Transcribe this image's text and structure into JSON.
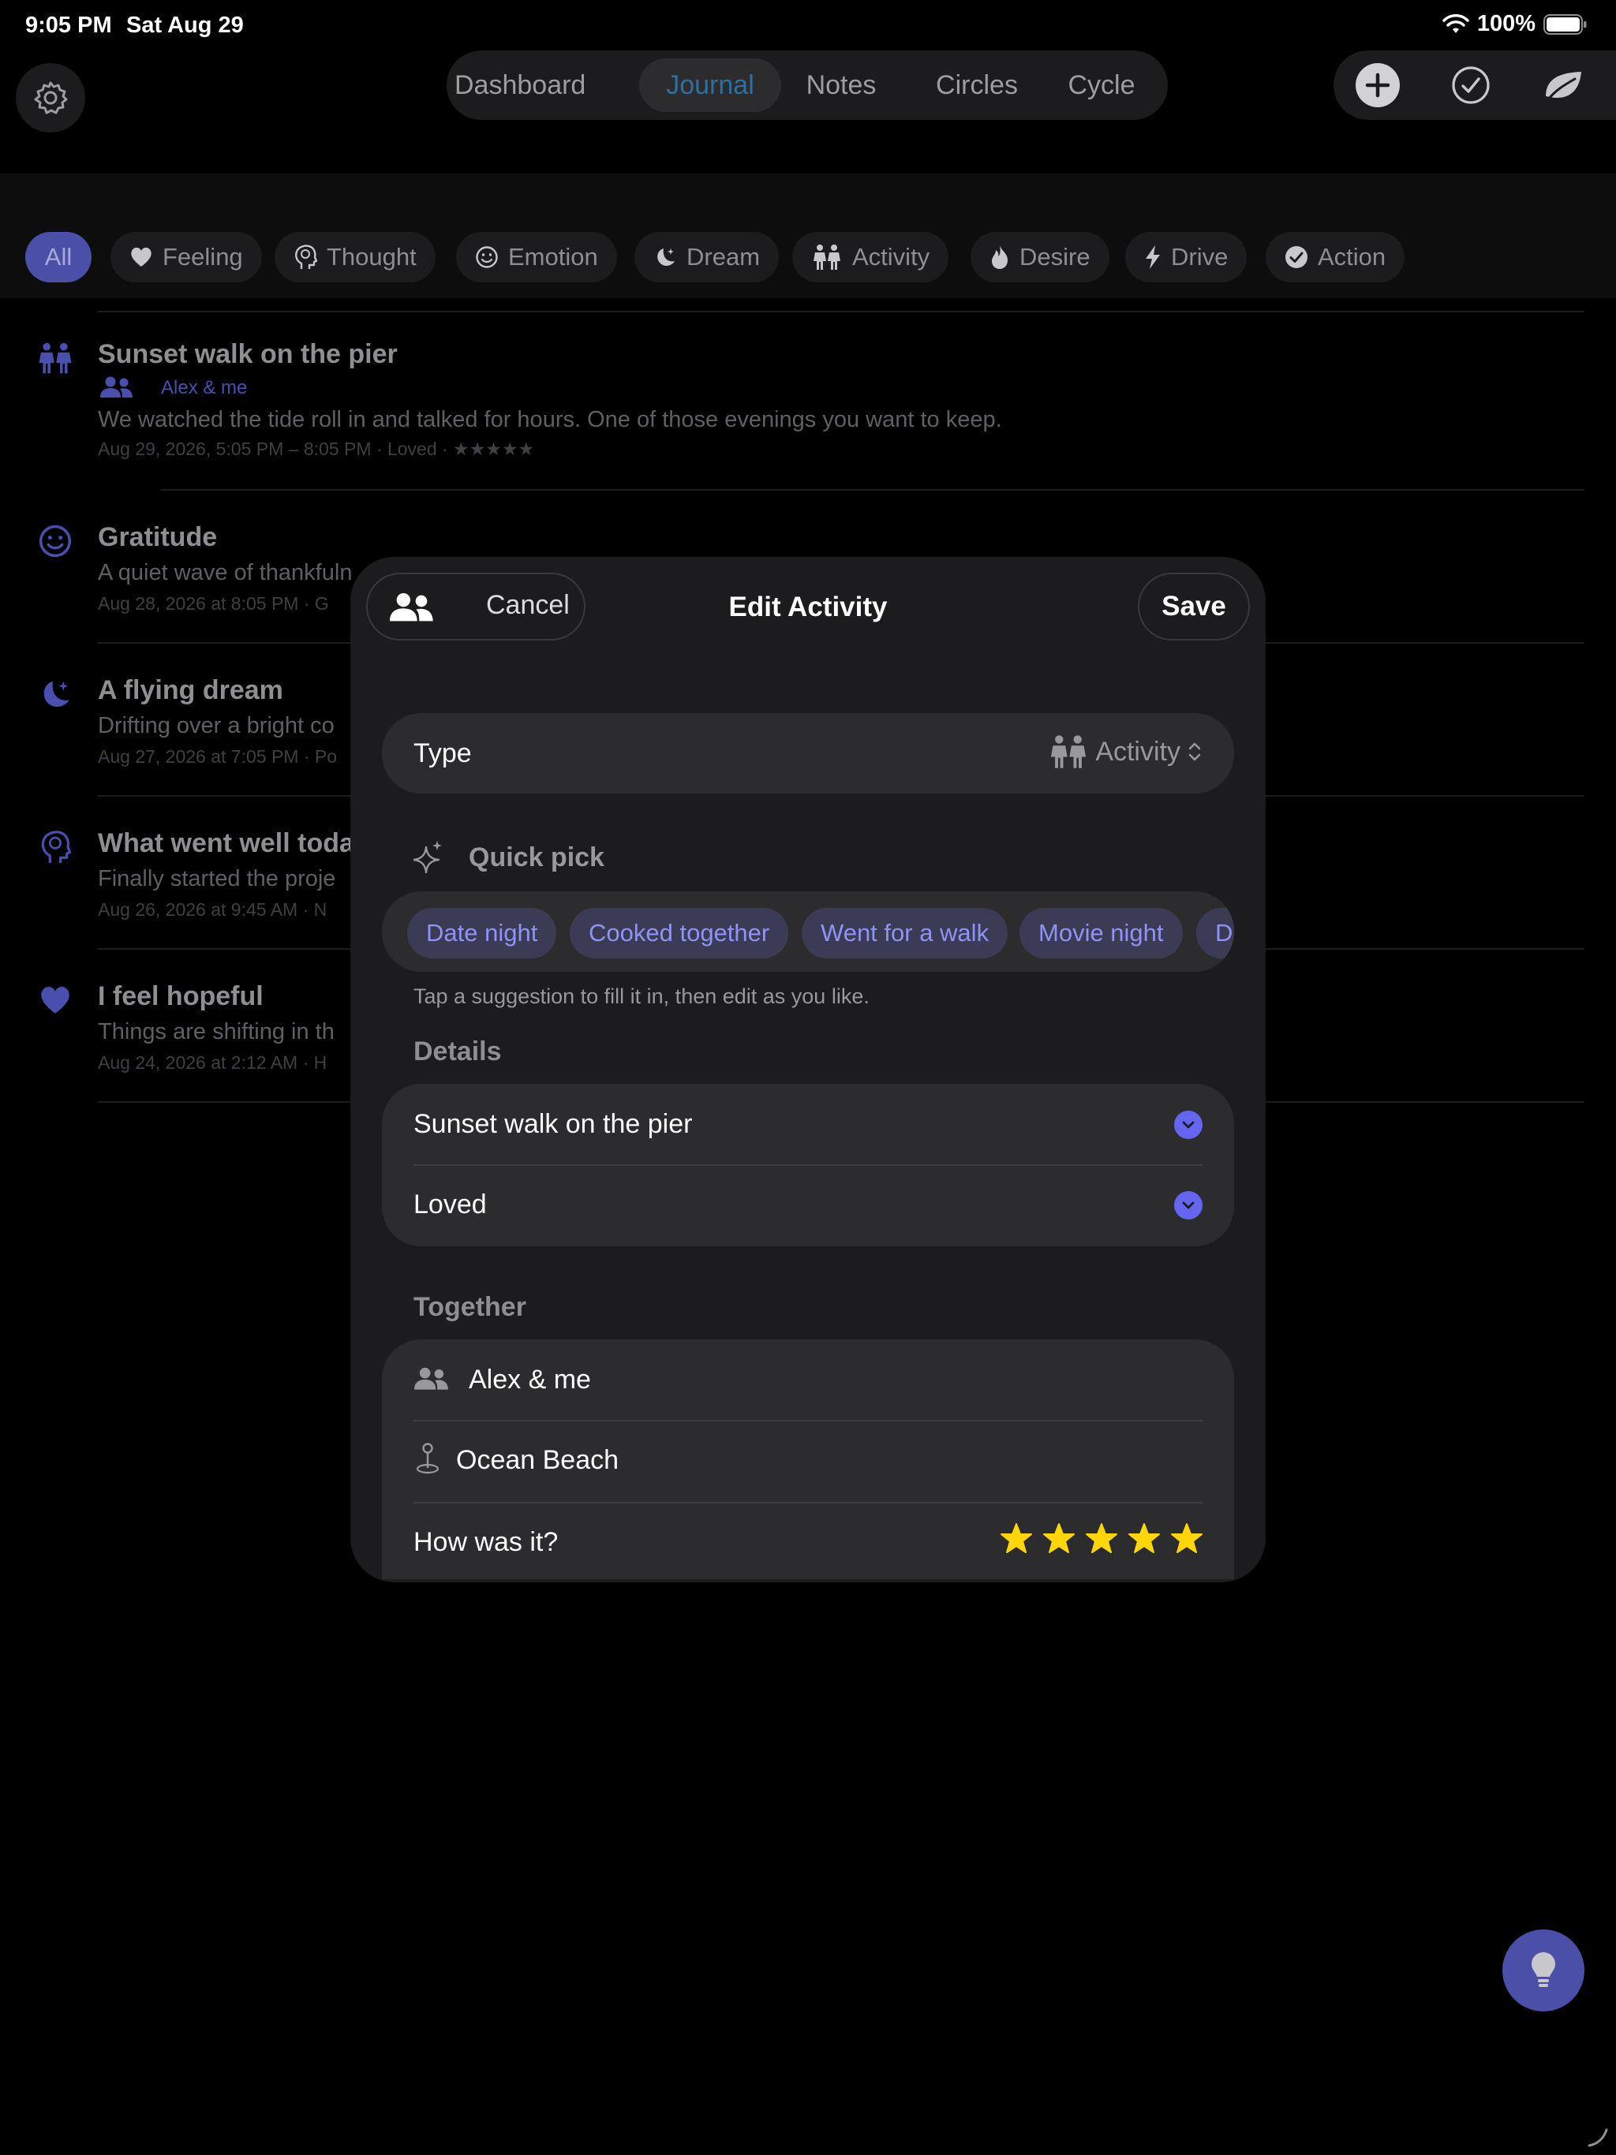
{
  "status_bar": {
    "time": "9:05 PM",
    "date": "Sat Aug 29",
    "battery": "100%"
  },
  "nav": {
    "tabs": [
      "Dashboard",
      "Journal",
      "Notes",
      "Circles",
      "Cycle"
    ],
    "active_tab": "Journal"
  },
  "filters": [
    "All",
    "Feeling",
    "Thought",
    "Emotion",
    "Dream",
    "Activity",
    "Desire",
    "Drive",
    "Action"
  ],
  "entries": [
    {
      "title": "Sunset walk on the pier",
      "with": "Alex & me",
      "body": "We watched the tide roll in and talked for hours. One of those evenings you want to keep.",
      "meta": "Aug 29, 2026, 5:05 PM – 8:05 PM  · Loved  · ★★★★★",
      "icon": "activity-icon"
    },
    {
      "title": "Gratitude",
      "body": "A quiet wave of thankfuln",
      "meta": "Aug 28, 2026 at 8:05 PM  · G",
      "icon": "emotion-icon"
    },
    {
      "title": "A flying dream",
      "body": "Drifting over a bright co",
      "meta": "Aug 27, 2026 at 7:05 PM  · Po",
      "icon": "dream-icon"
    },
    {
      "title": "What went well toda",
      "body": "Finally started the proje",
      "meta": "Aug 26, 2026 at 9:45 AM  · N",
      "icon": "thought-icon"
    },
    {
      "title": "I feel hopeful",
      "body": "Things are shifting in th",
      "meta": "Aug 24, 2026 at 2:12 AM  · H",
      "icon": "feeling-icon"
    }
  ],
  "modal": {
    "cancel": "Cancel",
    "title": "Edit Activity",
    "save": "Save",
    "type_label": "Type",
    "type_value": "Activity",
    "quick_pick_label": "Quick pick",
    "quick_picks": [
      "Date night",
      "Cooked together",
      "Went for a walk",
      "Movie night",
      "D"
    ],
    "hint": "Tap a suggestion to fill it in, then edit as you like.",
    "details_label": "Details",
    "detail_title": "Sunset walk on the pier",
    "detail_mood": "Loved",
    "together_label": "Together",
    "people": "Alex & me",
    "place": "Ocean Beach",
    "rating_label": "How was it?",
    "rating": 5,
    "rating_max": 5
  },
  "colors": {
    "accent": "#6466f1",
    "star": "#ffd60a",
    "active_tab": "#2f6fa0"
  }
}
